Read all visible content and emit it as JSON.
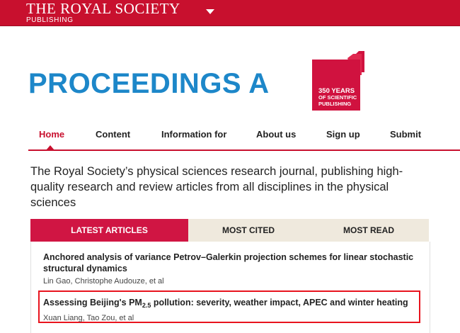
{
  "header": {
    "brand_line1": "THE ROYAL SOCIETY",
    "brand_line2": "PUBLISHING",
    "brand_menu_icon": "caret-down-icon",
    "color": "#c8102e"
  },
  "journal": {
    "title": "PROCEEDINGS A",
    "title_color": "#1d87c9",
    "anniversary_line1": "350 YEARS",
    "anniversary_line2": "OF SCIENTIFIC",
    "anniversary_line3": "PUBLISHING"
  },
  "nav": {
    "items": [
      "Home",
      "Content",
      "Information for",
      "About us",
      "Sign up",
      "Submit"
    ],
    "active": "Home"
  },
  "intro": "The Royal Society’s physical sciences research journal, publishing high-quality research and review articles from all disciplines in the physical sciences",
  "tabs": {
    "items": [
      "LATEST ARTICLES",
      "MOST CITED",
      "MOST READ"
    ],
    "active": "LATEST ARTICLES",
    "active_color": "#d01543"
  },
  "articles": [
    {
      "title": "Anchored analysis of variance Petrov–Galerkin projection schemes for linear stochastic structural dynamics",
      "authors": "Lin Gao,  Christophe Audouze, et al"
    },
    {
      "title_pre": "Assessing Beijing's PM",
      "title_sub": "2.5",
      "title_post": " pollution: severity, weather impact, APEC and winter heating",
      "authors": "Xuan Liang,  Tao Zou, et al",
      "highlight_color": "#e8141e"
    }
  ]
}
